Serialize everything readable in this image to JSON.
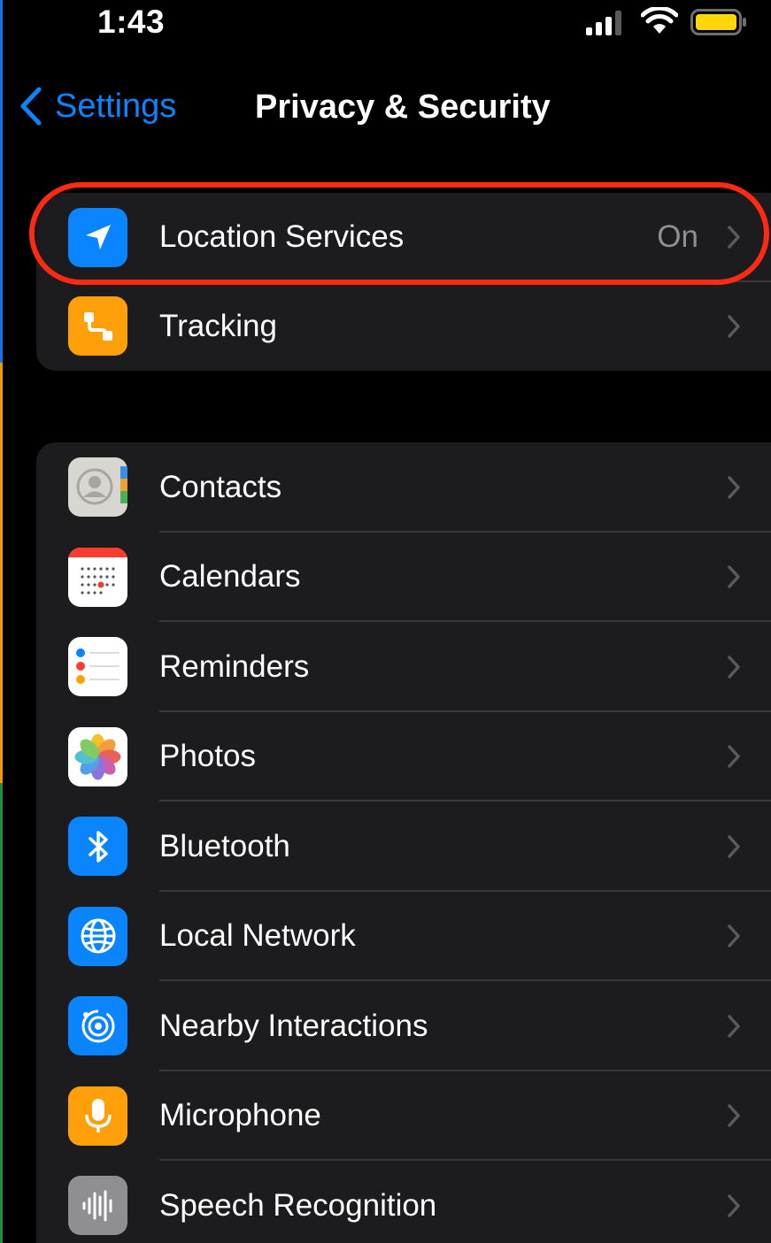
{
  "status_bar": {
    "time": "1:43"
  },
  "nav": {
    "back_label": "Settings",
    "title": "Privacy & Security"
  },
  "group1": [
    {
      "label": "Location Services",
      "value": "On",
      "icon": "location-arrow-icon",
      "color": "#0a84ff"
    },
    {
      "label": "Tracking",
      "value": "",
      "icon": "tracking-icon",
      "color": "#ff9f0a"
    }
  ],
  "group2": [
    {
      "label": "Contacts",
      "icon": "contacts-icon"
    },
    {
      "label": "Calendars",
      "icon": "calendar-icon"
    },
    {
      "label": "Reminders",
      "icon": "reminders-icon"
    },
    {
      "label": "Photos",
      "icon": "photos-icon"
    },
    {
      "label": "Bluetooth",
      "icon": "bluetooth-icon"
    },
    {
      "label": "Local Network",
      "icon": "globe-icon"
    },
    {
      "label": "Nearby Interactions",
      "icon": "nearby-interactions-icon"
    },
    {
      "label": "Microphone",
      "icon": "microphone-icon"
    },
    {
      "label": "Speech Recognition",
      "icon": "waveform-icon"
    }
  ],
  "colors": {
    "accent": "#0a84ff",
    "highlight": "#ff2a12",
    "background": "#000000",
    "cell": "#1c1c1e"
  }
}
